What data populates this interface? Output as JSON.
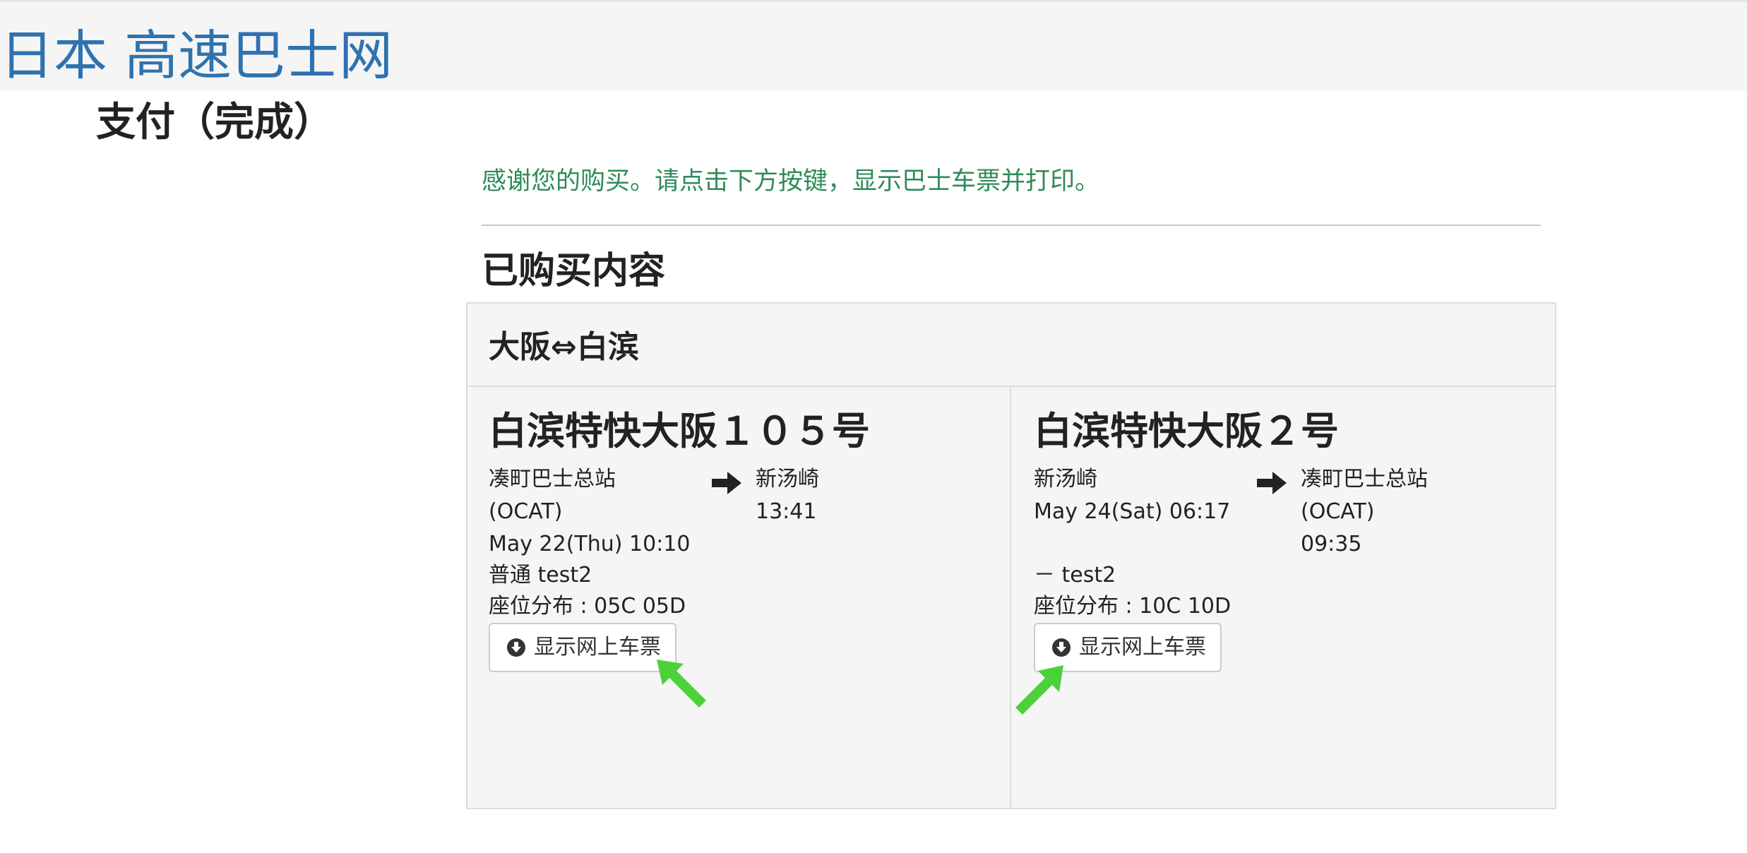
{
  "header": {
    "site_title": "日本 高速巴士网"
  },
  "page": {
    "title": "支付（完成）",
    "thanks_message": "感谢您的购买。请点击下方按键，显示巴士车票并打印。",
    "section_title": "已购买内容"
  },
  "route": {
    "title": "大阪⇔白滨"
  },
  "trips": [
    {
      "bus_name": "白滨特快大阪１０５号",
      "from_line1": "凑町巴士总站",
      "from_line2": "(OCAT)",
      "departure": "May 22(Thu) 10:10",
      "to_line1": "新汤崎",
      "arrival": "13:41",
      "fare": "普通 test2",
      "seats": "座位分布 : 05C 05D",
      "button_label": "显示网上车票"
    },
    {
      "bus_name": "白滨特快大阪２号",
      "from_line1": "新汤崎",
      "departure": "May 24(Sat) 06:17",
      "to_line1": "凑町巴士总站",
      "to_line2": "(OCAT)",
      "arrival": "09:35",
      "fare": "－ test2",
      "seats": "座位分布 : 10C 10D",
      "button_label": "显示网上车票"
    }
  ],
  "colors": {
    "site_title": "#2f72b0",
    "thanks": "#2e8b57",
    "pointer": "#4cd13a"
  },
  "icons": {
    "route_arrow": "arrow-right-icon",
    "download": "download-circle-icon",
    "annotation": "green-pointer-arrow-icon"
  }
}
